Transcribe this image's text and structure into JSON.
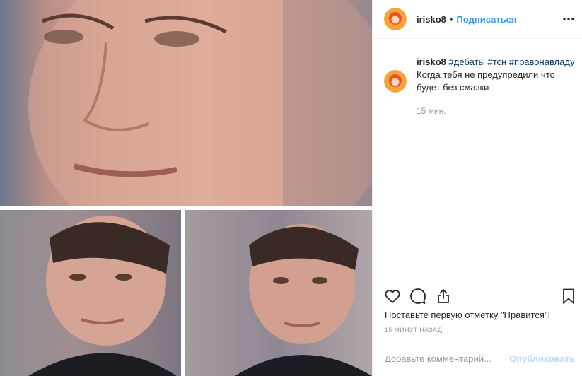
{
  "post": {
    "username": "irisko8",
    "follow_label": "Подписаться",
    "separator": "•"
  },
  "caption": {
    "username": "irisko8",
    "tags": [
      "#дебаты",
      "#тсн",
      "#правонавладу"
    ],
    "text": "Когда тебя не предупредили что будет без смазки",
    "time": "15 мин."
  },
  "actions": {
    "icons": [
      "heart-icon",
      "comment-icon",
      "share-icon",
      "bookmark-icon"
    ]
  },
  "likes_text": "Поставьте первую отметку \"Нравится\"!",
  "timestamp": "15 минут назад",
  "comment": {
    "placeholder": "Добавьте комментарий...",
    "post_label": "Опубликовать"
  },
  "colors": {
    "link": "#3897f0",
    "hashtag": "#003569",
    "muted": "#999999",
    "post_disabled": "#b3dbff"
  }
}
